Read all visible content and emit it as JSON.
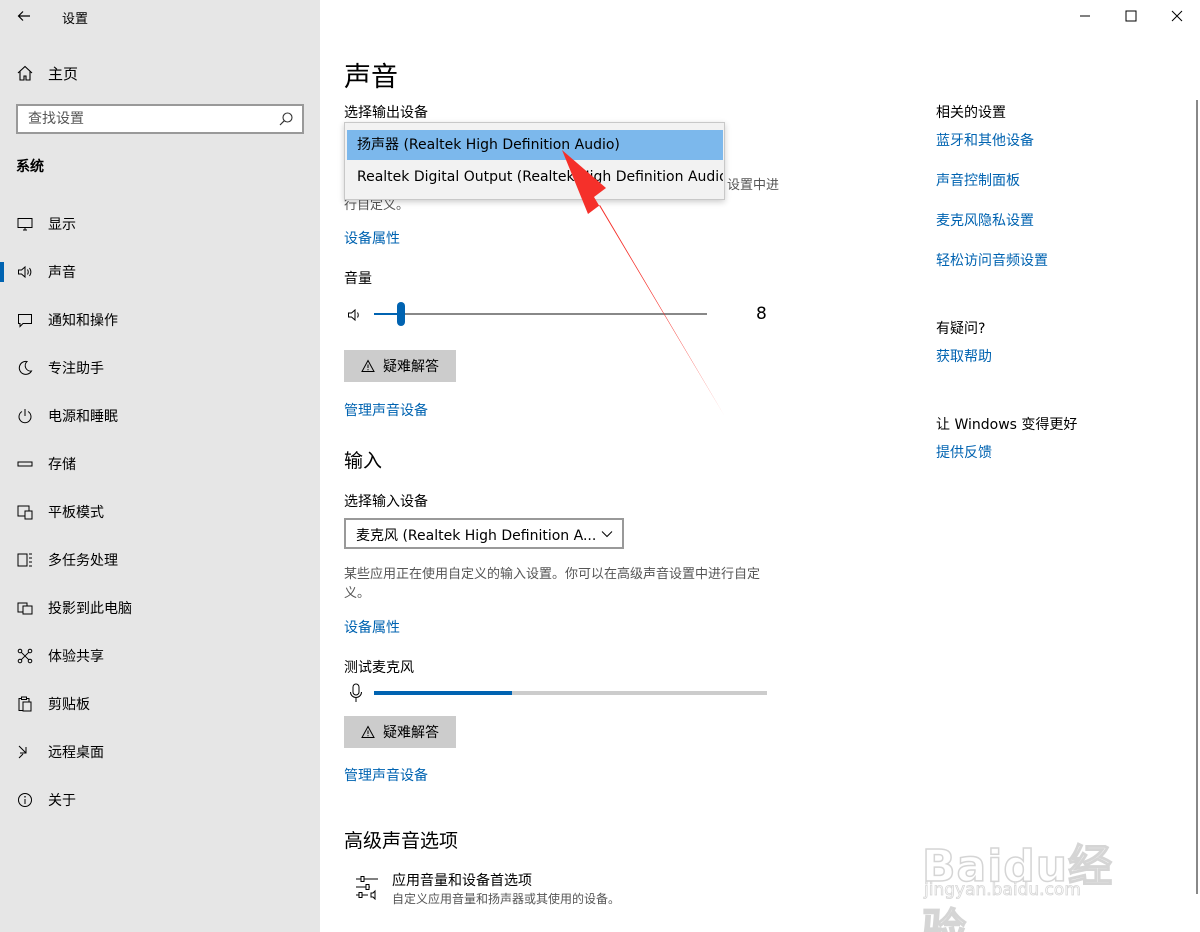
{
  "window": {
    "title": "设置"
  },
  "sidebar": {
    "home_label": "主页",
    "search_placeholder": "查找设置",
    "group_label": "系统",
    "items": [
      {
        "label": "显示",
        "icon": "monitor-icon"
      },
      {
        "label": "声音",
        "icon": "speaker-icon",
        "active": true
      },
      {
        "label": "通知和操作",
        "icon": "notification-icon"
      },
      {
        "label": "专注助手",
        "icon": "moon-icon"
      },
      {
        "label": "电源和睡眠",
        "icon": "power-icon"
      },
      {
        "label": "存储",
        "icon": "storage-icon"
      },
      {
        "label": "平板模式",
        "icon": "tablet-icon"
      },
      {
        "label": "多任务处理",
        "icon": "multitask-icon"
      },
      {
        "label": "投影到此电脑",
        "icon": "project-icon"
      },
      {
        "label": "体验共享",
        "icon": "share-icon"
      },
      {
        "label": "剪贴板",
        "icon": "clipboard-icon"
      },
      {
        "label": "远程桌面",
        "icon": "remote-icon"
      },
      {
        "label": "关于",
        "icon": "info-icon"
      }
    ]
  },
  "main": {
    "title": "声音",
    "output": {
      "select_label": "选择输出设备",
      "options": [
        "扬声器 (Realtek High Definition Audio)",
        "Realtek Digital Output (Realtek High Definition Audio)"
      ],
      "selected_index": 0,
      "desc_visible_part1": "设置中进",
      "desc_visible_part2": "行自定义。",
      "device_properties": "设备属性",
      "volume_label": "音量",
      "volume_value": "8",
      "troubleshoot": "疑难解答",
      "manage_devices": "管理声音设备"
    },
    "input": {
      "section_title": "输入",
      "select_label": "选择输入设备",
      "selected_value": "麦克风 (Realtek High Definition A...",
      "desc": "某些应用正在使用自定义的输入设置。你可以在高级声音设置中进行自定义。",
      "device_properties": "设备属性",
      "test_mic_label": "测试麦克风",
      "mic_level": 0.35,
      "troubleshoot": "疑难解答",
      "manage_devices": "管理声音设备"
    },
    "advanced": {
      "section_title": "高级声音选项",
      "option_title": "应用音量和设备首选项",
      "option_desc": "自定义应用音量和扬声器或其使用的设备。"
    }
  },
  "related": {
    "heading": "相关的设置",
    "links": [
      "蓝牙和其他设备",
      "声音控制面板",
      "麦克风隐私设置",
      "轻松访问音频设置"
    ],
    "question_heading": "有疑问?",
    "help_link": "获取帮助",
    "improve_heading": "让 Windows 变得更好",
    "feedback_link": "提供反馈"
  },
  "watermark": {
    "brand": "Baidu经验",
    "url": "jingyan.baidu.com"
  },
  "colors": {
    "accent": "#0063b1",
    "sidebar_bg": "#e6e6e6",
    "selected_option": "#7cb8ec",
    "arrow": "#f5302a"
  }
}
